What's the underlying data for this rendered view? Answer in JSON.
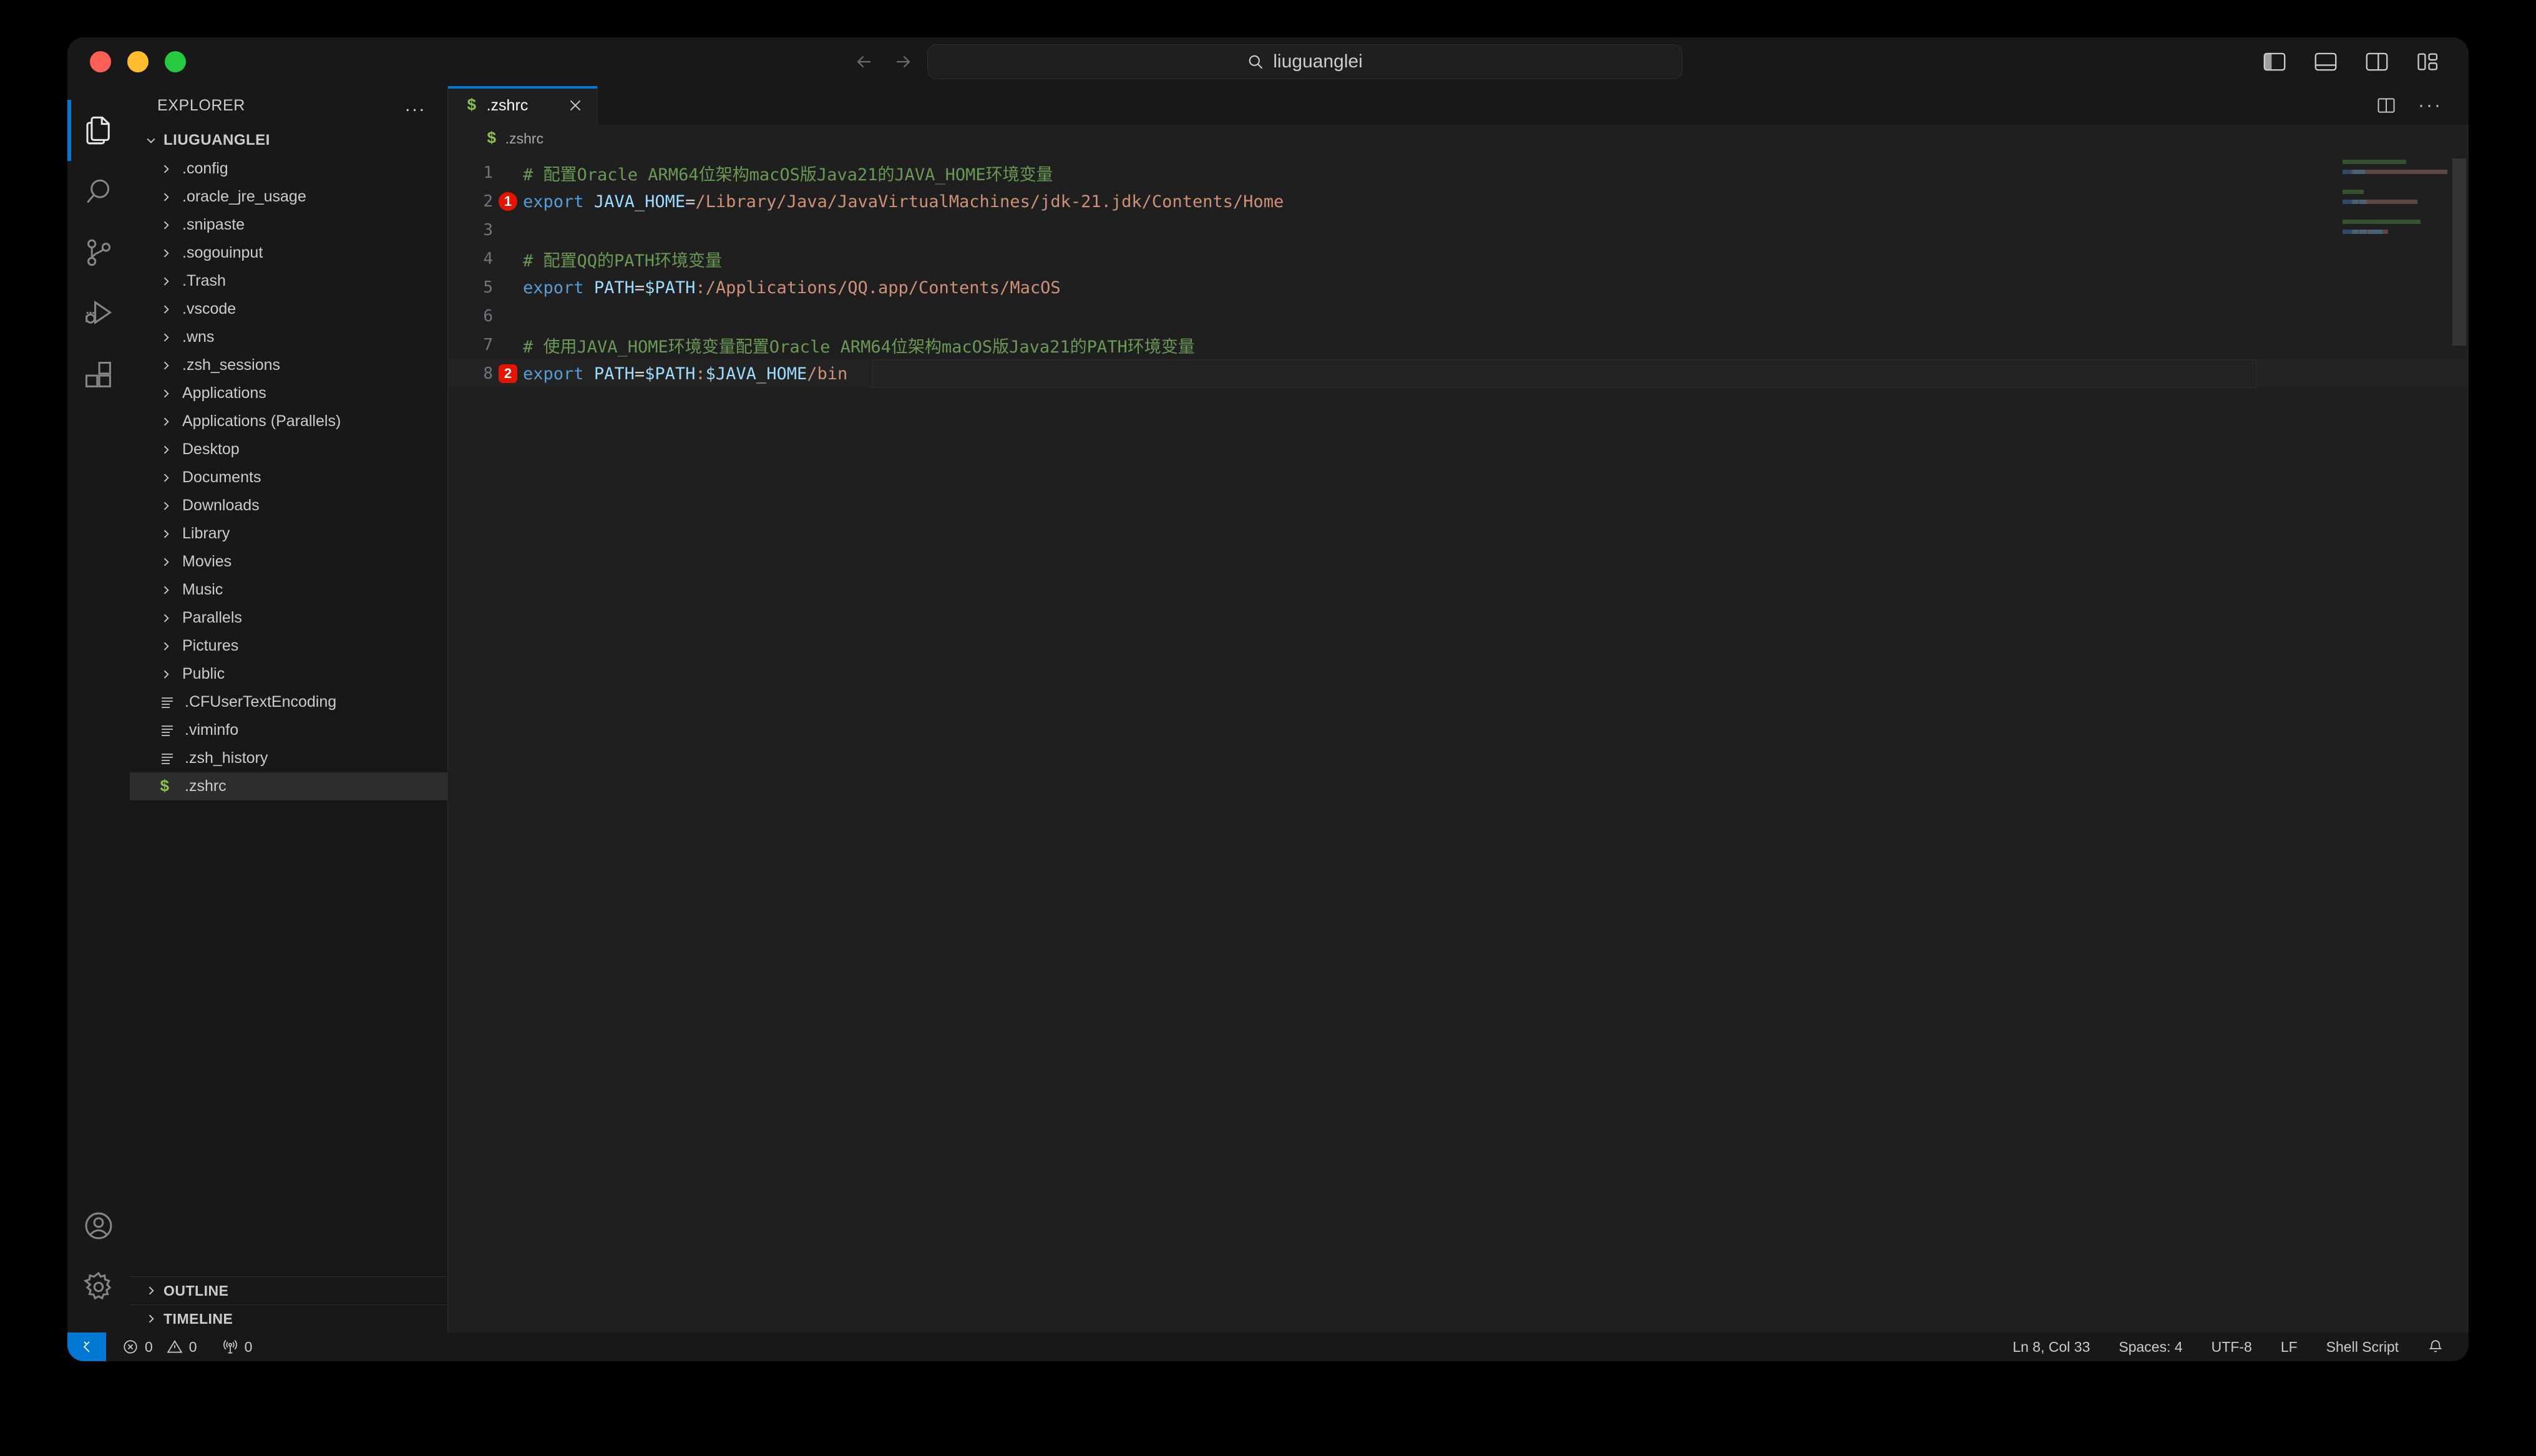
{
  "titlebar": {
    "search_value": "liuguanglei",
    "back_label": "Go Back",
    "forward_label": "Go Forward",
    "layout_icons": [
      "toggle-primary-sidebar",
      "toggle-panel",
      "toggle-secondary-sidebar",
      "customize-layout"
    ]
  },
  "activitybar": {
    "items": [
      {
        "name": "explorer",
        "label": "Explorer",
        "active": true
      },
      {
        "name": "search",
        "label": "Search",
        "active": false
      },
      {
        "name": "source-control",
        "label": "Source Control",
        "active": false
      },
      {
        "name": "run-debug",
        "label": "Run and Debug",
        "active": false
      },
      {
        "name": "extensions",
        "label": "Extensions",
        "active": false
      }
    ],
    "bottom": [
      {
        "name": "account",
        "label": "Accounts"
      },
      {
        "name": "settings",
        "label": "Manage"
      }
    ]
  },
  "sidebar": {
    "title": "EXPLORER",
    "actions_label": "...",
    "root": "LIUGUANGLEI",
    "items": [
      {
        "label": ".config",
        "type": "folder"
      },
      {
        "label": ".oracle_jre_usage",
        "type": "folder"
      },
      {
        "label": ".snipaste",
        "type": "folder"
      },
      {
        "label": ".sogouinput",
        "type": "folder"
      },
      {
        "label": ".Trash",
        "type": "folder"
      },
      {
        "label": ".vscode",
        "type": "folder"
      },
      {
        "label": ".wns",
        "type": "folder"
      },
      {
        "label": ".zsh_sessions",
        "type": "folder"
      },
      {
        "label": "Applications",
        "type": "folder"
      },
      {
        "label": "Applications (Parallels)",
        "type": "folder"
      },
      {
        "label": "Desktop",
        "type": "folder"
      },
      {
        "label": "Documents",
        "type": "folder"
      },
      {
        "label": "Downloads",
        "type": "folder"
      },
      {
        "label": "Library",
        "type": "folder"
      },
      {
        "label": "Movies",
        "type": "folder"
      },
      {
        "label": "Music",
        "type": "folder"
      },
      {
        "label": "Parallels",
        "type": "folder"
      },
      {
        "label": "Pictures",
        "type": "folder"
      },
      {
        "label": "Public",
        "type": "folder"
      },
      {
        "label": ".CFUserTextEncoding",
        "type": "file"
      },
      {
        "label": ".viminfo",
        "type": "file"
      },
      {
        "label": ".zsh_history",
        "type": "file"
      },
      {
        "label": ".zshrc",
        "type": "shell",
        "selected": true
      }
    ],
    "sections": [
      {
        "label": "OUTLINE",
        "expanded": false
      },
      {
        "label": "TIMELINE",
        "expanded": false
      }
    ]
  },
  "editor": {
    "tab": {
      "label": ".zshrc",
      "icon": "$",
      "close_label": "Close"
    },
    "breadcrumb": {
      "icon": "$",
      "label": ".zshrc"
    },
    "actions": [
      "split-editor",
      "more-actions"
    ],
    "lines": [
      {
        "num": "1",
        "badge": "",
        "segments": [
          {
            "t": "# 配置Oracle ARM64位架构macOS版Java21的JAVA_HOME环境变量",
            "c": "cm"
          }
        ]
      },
      {
        "num": "2",
        "badge": "1",
        "badge_shape": "circle",
        "segments": [
          {
            "t": "export",
            "c": "kw"
          },
          {
            "t": " ",
            "c": "op"
          },
          {
            "t": "JAVA_HOME",
            "c": "var"
          },
          {
            "t": "=",
            "c": "op"
          },
          {
            "t": "/Library/Java/JavaVirtualMachines/jdk-21.jdk/Contents/Home",
            "c": "str"
          }
        ]
      },
      {
        "num": "3",
        "badge": "",
        "segments": []
      },
      {
        "num": "4",
        "badge": "",
        "segments": [
          {
            "t": "# 配置QQ的PATH环境变量",
            "c": "cm"
          }
        ]
      },
      {
        "num": "5",
        "badge": "",
        "segments": [
          {
            "t": "export",
            "c": "kw"
          },
          {
            "t": " ",
            "c": "op"
          },
          {
            "t": "PATH",
            "c": "var"
          },
          {
            "t": "=",
            "c": "op"
          },
          {
            "t": "$PATH",
            "c": "var"
          },
          {
            "t": ":",
            "c": "str"
          },
          {
            "t": "/Applications/QQ.app/Contents/MacOS",
            "c": "str"
          }
        ]
      },
      {
        "num": "6",
        "badge": "",
        "segments": []
      },
      {
        "num": "7",
        "badge": "",
        "segments": [
          {
            "t": "# 使用JAVA_HOME环境变量配置Oracle ARM64位架构macOS版Java21的PATH环境变量",
            "c": "cm"
          }
        ]
      },
      {
        "num": "8",
        "badge": "2",
        "badge_shape": "square",
        "current": true,
        "segments": [
          {
            "t": "export",
            "c": "kw"
          },
          {
            "t": " ",
            "c": "op"
          },
          {
            "t": "PATH",
            "c": "var"
          },
          {
            "t": "=",
            "c": "op"
          },
          {
            "t": "$PATH",
            "c": "var"
          },
          {
            "t": ":",
            "c": "str"
          },
          {
            "t": "$JAVA_HOME",
            "c": "var"
          },
          {
            "t": "/bin",
            "c": "str"
          }
        ]
      }
    ]
  },
  "statusbar": {
    "remote_label": "Open a Remote Window",
    "errors": "0",
    "warnings": "0",
    "ports": "0",
    "position": "Ln 8, Col 33",
    "indentation": "Spaces: 4",
    "encoding": "UTF-8",
    "eol": "LF",
    "language": "Shell Script",
    "notifications_label": "Notifications"
  },
  "colors": {
    "accent": "#0078d4",
    "badge_red": "#e51400",
    "shell_green": "#8dc149",
    "comment": "#6a9955",
    "keyword": "#569cd6",
    "variable": "#9cdcfe",
    "string": "#ce9178"
  }
}
